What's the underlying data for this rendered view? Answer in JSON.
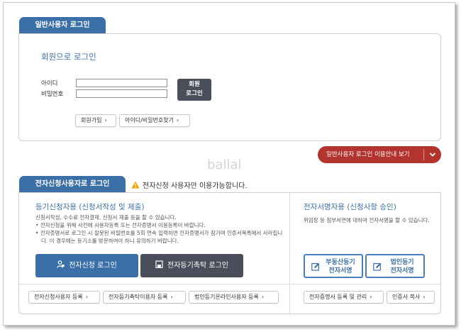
{
  "general_login": {
    "tab_label": "일반사용자 로그인",
    "member_login_title": "회원으로 로그인",
    "id_label": "아이디",
    "password_label": "비밀번호",
    "id_value": "",
    "password_value": "",
    "login_button": {
      "line1": "회원",
      "line2": "로그인"
    },
    "signup_button": "회원가입",
    "find_button": "아이디/비밀번호찾기"
  },
  "guide_bar_label": "일반사용자 로그인 이용안내 보기",
  "watermark_text": "ballal",
  "e_login": {
    "tab_label": "전자신청사용자로 로그인",
    "notice": "전자신청 사용자만 이용가능합니다.",
    "register_section": {
      "title": "등기신청자용 (신청서작성 및 제출)",
      "intro": "신청서작성, 수수료 전자결제, 신청서 제출 등을 할 수 있습니다.",
      "bullets": [
        "전자신청을 위해 사전에 사용자등록 또는 전자증명서 이용등록이 바랍니다.",
        "전자증명서로 로그인 시 잘못된 비밀번호를 5회 연속 입력하면 전자증명서가 잠기며 인증서목록에서 사라집니다. 이 경우에는 등기소를 방문하여야 하니 유의하기 바랍니다."
      ],
      "e_apply_login": "전자신청 로그인",
      "e_trust_login": "전자등기촉탁 로그인"
    },
    "sign_section": {
      "title": "전자서명자용 (신청사항 승인)",
      "desc": "위임장 등 첨부서면에 대하여 전자서명을 할 수 있습니다.",
      "real_estate_sign": {
        "line1": "부동산등기",
        "line2": "전자서명"
      },
      "corp_sign": {
        "line1": "법인등기",
        "line2": "전자서명"
      }
    },
    "bottom_links": {
      "applicant_register": "전자신청사용자 등록",
      "trust_user_register": "전자등기촉탁이용자 등록",
      "corp_online_register": "법인등기온라인사용자 등록",
      "cert_manage": "전자증명서 등록 및 관리",
      "cert_copy": "인증서 복사"
    }
  },
  "colors": {
    "tab_blue": "#3a6fa8",
    "guide_red": "#b3332e",
    "dark_button": "#4a4d5a",
    "apply_button_blue": "#3a6fa8"
  }
}
